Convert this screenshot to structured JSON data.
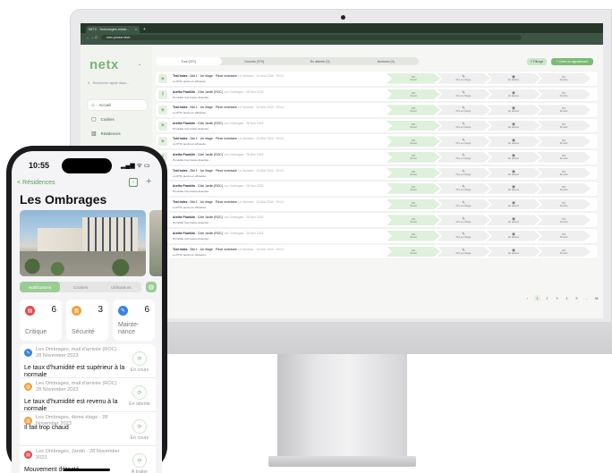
{
  "browser": {
    "tab_title": "NETX - Technologies embar...",
    "tab_close": "×",
    "new_tab": "+",
    "url": "netx.prinser.tech",
    "nav": "← → C"
  },
  "app": {
    "logo": "netx",
    "search_placeholder": "Recherche rapide dans...",
    "sidebar": [
      {
        "label": "Accueil",
        "icon": "home-icon",
        "glyph": "⌂",
        "active": true
      },
      {
        "label": "Cockies",
        "icon": "document-icon",
        "glyph": "▢",
        "active": false
      },
      {
        "label": "Résidences",
        "icon": "building-icon",
        "glyph": "▥",
        "active": false
      },
      {
        "label": "Analytics",
        "icon": "chart-icon",
        "glyph": "▮",
        "active": false,
        "badge": "BIENTÔT"
      },
      {
        "label": "API",
        "icon": "api-icon",
        "glyph": "⚲",
        "active": false
      }
    ],
    "filters": [
      "Tout (370)",
      "Ouverts (370)",
      "En attente (0)",
      "Archivés (0)"
    ],
    "filter_button": "Y Filtrage",
    "create_button": "+ Créer un signalement",
    "stages": [
      "Ouvert",
      "Pris en charge",
      "En attente",
      "Terminé"
    ],
    "rows": [
      {
        "title": "Test Index",
        "detail": " - Bât 1 · 1er étage · Pièce inventaire",
        "meta": "  Le Hameau · 24 Mar 2024 · 09:41",
        "sub": "Le PHC perdu en efficacité",
        "icon": "sun"
      },
      {
        "title": "Arethe Franklin",
        "detail": " - Côté Jardin (ROC)",
        "meta": "  Les Ombrages · 28 Nov 2023",
        "sub": "Humidité trop basse détectée",
        "icon": "thermo"
      },
      {
        "title": "Test Index",
        "detail": " - Bât 1 · 1er étage · Pièce inventaire",
        "meta": "  Le Hameau · 24 Mar 2024 · 09:41",
        "sub": "Le PHC perdu en efficacité",
        "icon": "sun"
      },
      {
        "title": "Arethe Franklin",
        "detail": " - Côté Jardin (ROC)",
        "meta": "  Les Ombrages · 28 Nov 2023",
        "sub": "Humidité trop basse détectée",
        "icon": "sun"
      },
      {
        "title": "Test Index",
        "detail": " - Bât 1 · 1er étage · Pièce inventaire",
        "meta": "  Le Hameau · 24 Mar 2024 · 09:41",
        "sub": "Le PHC perdu en efficacité",
        "icon": "sun"
      },
      {
        "title": "Arethe Franklin",
        "detail": " - Côté Jardin (ROC)",
        "meta": "  Les Ombrages · 28 Nov 2023",
        "sub": "Humidité trop basse détectée",
        "icon": "thermo"
      },
      {
        "title": "Test Index",
        "detail": " - Bât 1 · 1er étage · Pièce inventaire",
        "meta": "  Le Hameau · 24 Mar 2024 · 09:41",
        "sub": "Le PHC perdu en efficacité",
        "icon": "thermo"
      },
      {
        "title": "Arethe Franklin",
        "detail": " - Côté Jardin (ROC)",
        "meta": "  Les Ombrages · 28 Nov 2023",
        "sub": "Humidité trop basse détectée",
        "icon": "thermo"
      },
      {
        "title": "Test Index",
        "detail": " - Bât 1 · 1er étage · Pièce inventaire",
        "meta": "  Le Hameau · 24 Mar 2024 · 09:41",
        "sub": "Le PHC perdu en efficacité",
        "icon": "thermo"
      },
      {
        "title": "Arethe Franklin",
        "detail": " - Côté Jardin (ROC)",
        "meta": "  Les Ombrages · 28 Nov 2023",
        "sub": "Humidité trop basse détectée",
        "icon": "thermo"
      },
      {
        "title": "Arethe Franklin",
        "detail": " - Côté Jardin (ROC)",
        "meta": "  Les Ombrages · 28 Nov 2023",
        "sub": "Humidité trop basse détectée",
        "icon": "thermo"
      },
      {
        "title": "Test Index",
        "detail": " - Bât 1 · 1er étage · Pièce inventaire",
        "meta": "  Le Hameau · 24 Mar 2024 · 09:41",
        "sub": "Le PHC perdu en efficacité",
        "icon": "thermo"
      }
    ],
    "pager": [
      "‹",
      "1",
      "2",
      "3",
      "4",
      "5",
      "…",
      "38",
      "›"
    ],
    "pager_current": "1"
  },
  "phone": {
    "time": "10:55",
    "status": "▂▄▆ ᯤ ▭",
    "back": "< Résidences",
    "title": "Les Ombrages",
    "tabs": [
      "Notifications",
      "Cockies",
      "Utilisateurs"
    ],
    "tab_active": "Notifications",
    "tab_button": "⚙",
    "cards": [
      {
        "label": "Critique",
        "count": "6",
        "color": "#e24a4a",
        "glyph": "▤"
      },
      {
        "label": "Sécurité",
        "count": "3",
        "color": "#f0a13a",
        "glyph": "▥"
      },
      {
        "label": "Mainte-\nnance",
        "count": "6",
        "color": "#3b82e0",
        "glyph": "✎"
      }
    ],
    "notifications": [
      {
        "meta": "Les Ombrages, mail d'arrivée (ROC) · 28 November 2023",
        "text": "Le taux d'humidité est supérieur à la normale",
        "status": "En cours",
        "color": "#3b82e0",
        "glyph": "✎"
      },
      {
        "meta": "Les Ombrages, mail d'arrivée (ROC) · 28 November 2023",
        "text": "Le taux d'humidité est revenu à la normale",
        "status": "En attente",
        "color": "#f0a13a",
        "glyph": "▥"
      },
      {
        "meta": "Les Ombrages, 4ème étage · 28 November 2023",
        "text": "Il fait trop chaud",
        "status": "En cours",
        "color": "#f0a13a",
        "glyph": "▥"
      },
      {
        "meta": "Les Ombrages, Jardin · 28 November 2023",
        "text": "Mouvement détecté",
        "status": "À traiter",
        "color": "#e24a4a",
        "glyph": "▤"
      }
    ]
  },
  "colors": {
    "accent": "#7bbb76",
    "dark_chrome": "#24372a",
    "critical": "#e24a4a",
    "security": "#f0a13a",
    "maintenance": "#3b82e0"
  }
}
